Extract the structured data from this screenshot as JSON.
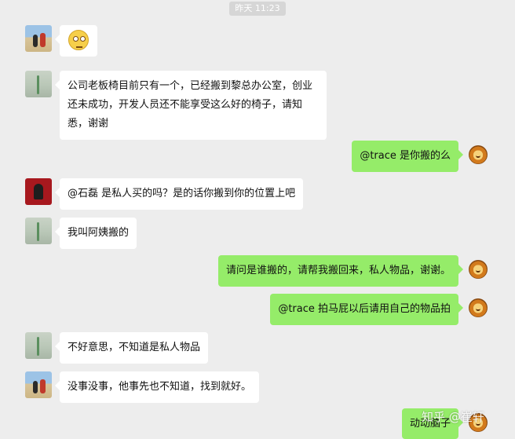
{
  "timestamp": "昨天 11:23",
  "messages": [
    {
      "side": "left",
      "avatar": "beach-couple",
      "text": ""
    },
    {
      "side": "left",
      "avatar": "grass",
      "text": "公司老板椅目前只有一个，已经搬到黎总办公室，创业还未成功，开发人员还不能享受这么好的椅子，请知悉，谢谢"
    },
    {
      "side": "right",
      "avatar": "lion",
      "text": "@trace 是你搬的么"
    },
    {
      "side": "left",
      "avatar": "red-portrait",
      "text": "@石磊 是私人买的吗？是的话你搬到你的位置上吧"
    },
    {
      "side": "left",
      "avatar": "grass",
      "text": "我叫阿姨搬的"
    },
    {
      "side": "right",
      "avatar": "lion",
      "text": "请问是谁搬的，请帮我搬回来，私人物品，谢谢。"
    },
    {
      "side": "right",
      "avatar": "lion",
      "text": "@trace 拍马屁以后请用自己的物品拍"
    },
    {
      "side": "left",
      "avatar": "grass",
      "text": "不好意思，不知道是私人物品"
    },
    {
      "side": "left",
      "avatar": "beach-couple",
      "text": "没事没事，他事先也不知道，找到就好。"
    },
    {
      "side": "right",
      "avatar": "lion",
      "text": "动动脑子"
    }
  ],
  "watermark": "知乎 @崔轩",
  "colors": {
    "background": "#ededed",
    "bubble_self": "#95ec69",
    "bubble_other": "#ffffff"
  },
  "icons": [
    "dizzy-face-emoji",
    "lion-avatar"
  ]
}
